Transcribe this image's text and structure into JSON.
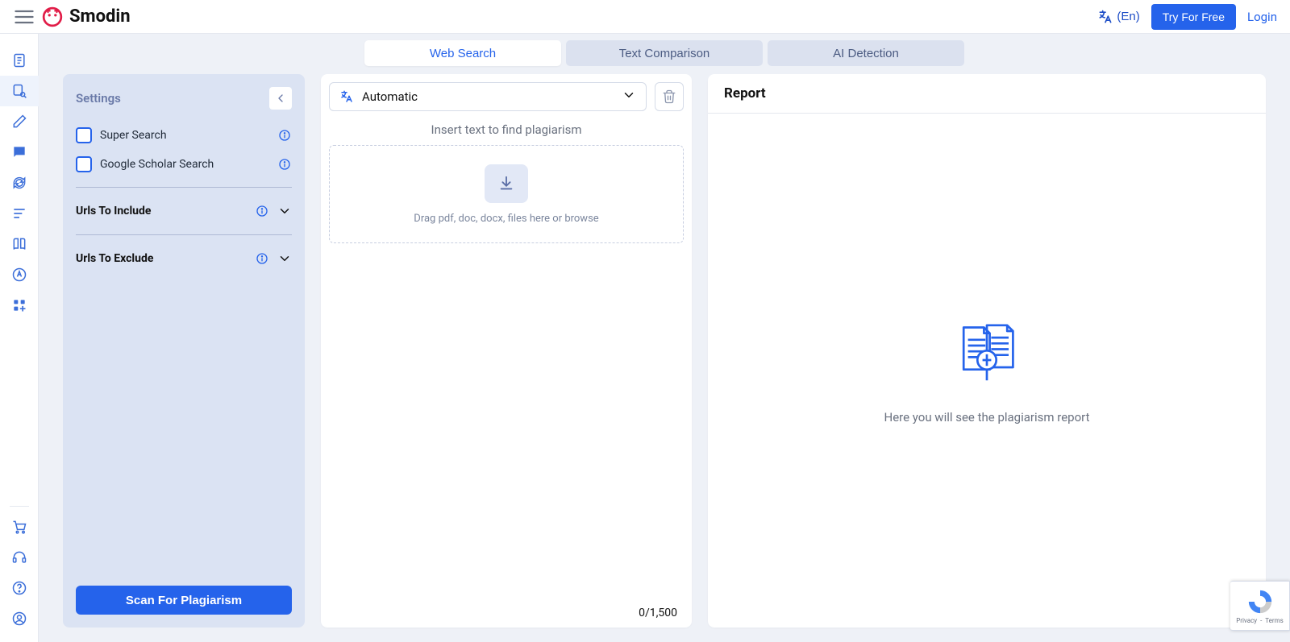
{
  "header": {
    "app_name": "Smodin",
    "lang_label": "(En)",
    "try_label": "Try For Free",
    "login_label": "Login"
  },
  "tabs": {
    "web_search": "Web Search",
    "text_comparison": "Text Comparison",
    "ai_detection": "AI Detection"
  },
  "settings": {
    "title": "Settings",
    "super_search": "Super Search",
    "google_scholar": "Google Scholar Search",
    "urls_include": "Urls To Include",
    "urls_exclude": "Urls To Exclude",
    "scan_button": "Scan For Plagiarism"
  },
  "input": {
    "lang_selected": "Automatic",
    "insert_prompt": "Insert text to find plagiarism",
    "dropzone_text": "Drag pdf, doc, docx, files here or browse",
    "counter": "0/1,500"
  },
  "report": {
    "title": "Report",
    "placeholder": "Here you will see the plagiarism report"
  },
  "recaptcha": {
    "privacy": "Privacy",
    "terms": "Terms"
  }
}
